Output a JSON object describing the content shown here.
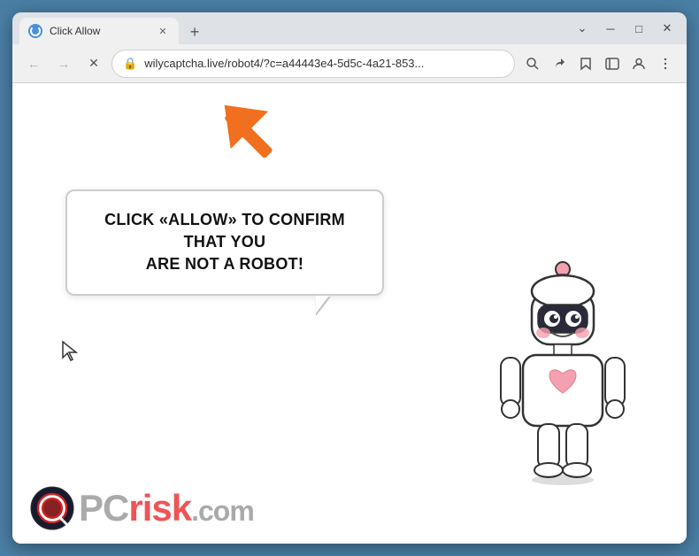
{
  "browser": {
    "tab": {
      "title": "Click Allow",
      "favicon_state": "loading"
    },
    "window_controls": {
      "chevron_down": "⌄",
      "minimize": "─",
      "maximize": "□",
      "close": "✕"
    },
    "nav": {
      "back_label": "←",
      "forward_label": "→",
      "reload_label": "✕"
    },
    "address": {
      "url": "wilycaptcha.live/robot4/?c=a44443e4-5d5c-4a21-853...",
      "lock_icon": "🔒"
    },
    "toolbar_actions": {
      "search": "⌕",
      "share": "↗",
      "bookmark": "☆",
      "sidebar": "▱",
      "profile": "👤",
      "menu": "⋮"
    }
  },
  "content": {
    "bubble_text_line1": "CLICK «ALLOW» TO CONFIRM THAT YOU",
    "bubble_text_line2": "ARE NOT A ROBOT!",
    "logo_text_pc": "PC",
    "logo_text_risk": "risk",
    "logo_text_domain": ".com"
  },
  "colors": {
    "browser_bg": "#dee1e6",
    "content_bg": "#ffffff",
    "tab_active_bg": "#f0f0f0",
    "address_bar_bg": "#ffffff",
    "arrow_orange": "#f07020",
    "bubble_border": "#cccccc",
    "text_dark": "#111111",
    "logo_gray": "#aaaaaa",
    "logo_red": "#ee5555",
    "outer_bg": "#4a7fa5"
  }
}
